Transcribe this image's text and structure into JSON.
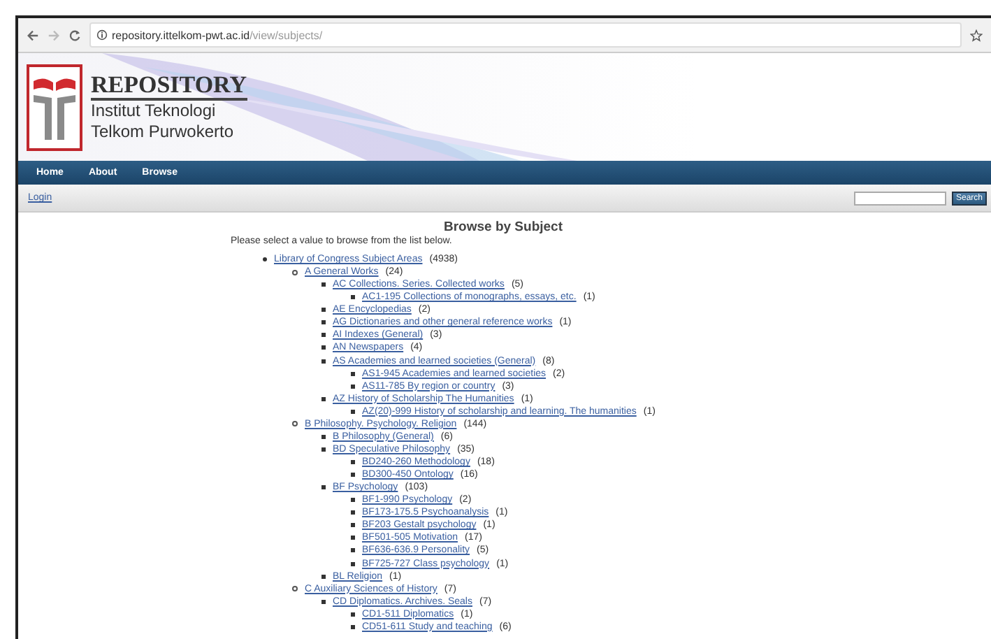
{
  "browser": {
    "url_host": "repository.ittelkom-pwt.ac.id",
    "url_path": "/view/subjects/"
  },
  "header": {
    "title": "REPOSITORY",
    "subtitle_lines": [
      "Institut Teknologi",
      "Telkom Purwokerto"
    ]
  },
  "nav": [
    "Home",
    "About",
    "Browse"
  ],
  "toolbar": {
    "login": "Login",
    "search_button": "Search"
  },
  "page": {
    "title": "Browse by Subject",
    "intro": "Please select a value to browse from the list below."
  },
  "subjects": [
    {
      "label": "Library of Congress Subject Areas",
      "count": "(4938)",
      "children": [
        {
          "label": "A General Works",
          "count": "(24)",
          "children": [
            {
              "label": "AC Collections. Series. Collected works",
              "count": "(5)",
              "children": [
                {
                  "label": "AC1-195 Collections of monographs, essays, etc.",
                  "count": "(1)"
                }
              ]
            },
            {
              "label": "AE Encyclopedias",
              "count": "(2)"
            },
            {
              "label": "AG Dictionaries and other general reference works",
              "count": "(1)"
            },
            {
              "label": "AI Indexes (General)",
              "count": "(3)"
            },
            {
              "label": "AN Newspapers",
              "count": "(4)"
            },
            {
              "label": "AS Academies and learned societies (General)",
              "count": "(8)",
              "children": [
                {
                  "label": "AS1-945 Academies and learned societies",
                  "count": "(2)"
                },
                {
                  "label": "AS11-785 By region or country",
                  "count": "(3)"
                }
              ]
            },
            {
              "label": "AZ History of Scholarship The Humanities",
              "count": "(1)",
              "children": [
                {
                  "label": "AZ(20)-999 History of scholarship and learning. The humanities",
                  "count": "(1)"
                }
              ]
            }
          ]
        },
        {
          "label": "B Philosophy. Psychology. Religion",
          "count": "(144)",
          "children": [
            {
              "label": "B Philosophy (General)",
              "count": "(6)"
            },
            {
              "label": "BD Speculative Philosophy",
              "count": "(35)",
              "children": [
                {
                  "label": "BD240-260 Methodology",
                  "count": "(18)"
                },
                {
                  "label": "BD300-450 Ontology",
                  "count": "(16)"
                }
              ]
            },
            {
              "label": "BF Psychology",
              "count": "(103)",
              "children": [
                {
                  "label": "BF1-990 Psychology",
                  "count": "(2)"
                },
                {
                  "label": "BF173-175.5 Psychoanalysis",
                  "count": "(1)"
                },
                {
                  "label": "BF203 Gestalt psychology",
                  "count": "(1)"
                },
                {
                  "label": "BF501-505 Motivation",
                  "count": "(17)"
                },
                {
                  "label": "BF636-636.9 Personality",
                  "count": "(5)"
                },
                {
                  "label": "BF725-727 Class psychology",
                  "count": "(1)"
                }
              ]
            },
            {
              "label": "BL Religion",
              "count": "(1)"
            }
          ]
        },
        {
          "label": "C Auxiliary Sciences of History",
          "count": "(7)",
          "children": [
            {
              "label": "CD Diplomatics. Archives. Seals",
              "count": "(7)",
              "children": [
                {
                  "label": "CD1-511 Diplomatics",
                  "count": "(1)"
                },
                {
                  "label": "CD51-611 Study and teaching",
                  "count": "(6)"
                }
              ]
            }
          ]
        }
      ]
    }
  ]
}
